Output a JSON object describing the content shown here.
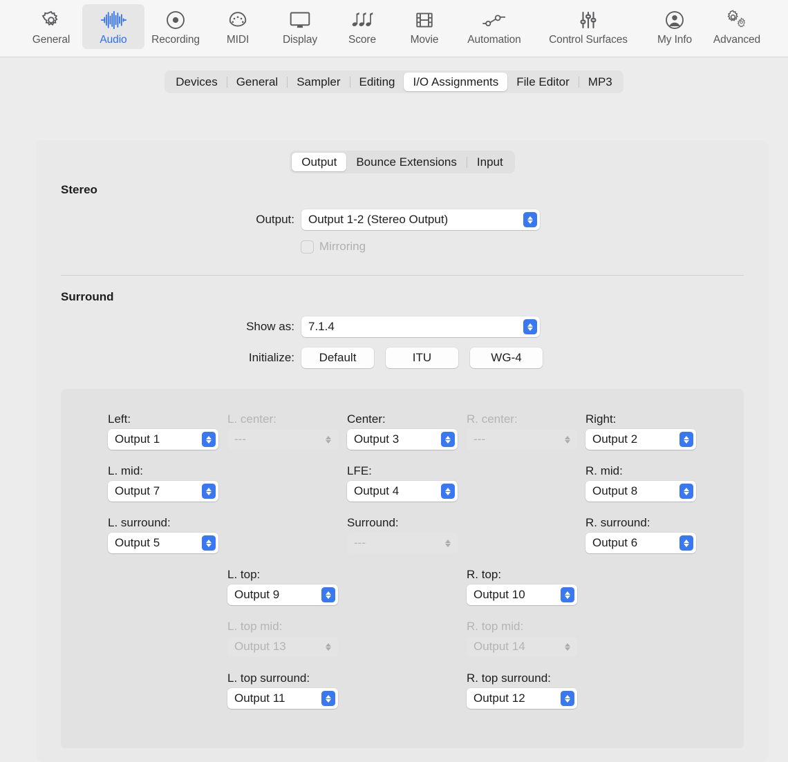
{
  "toolbar": {
    "items": [
      {
        "label": "General",
        "icon": "gear-icon",
        "selected": false
      },
      {
        "label": "Audio",
        "icon": "waveform-icon",
        "selected": true
      },
      {
        "label": "Recording",
        "icon": "record-circle-icon",
        "selected": false
      },
      {
        "label": "MIDI",
        "icon": "midi-connector-icon",
        "selected": false
      },
      {
        "label": "Display",
        "icon": "monitor-icon",
        "selected": false
      },
      {
        "label": "Score",
        "icon": "music-notes-icon",
        "selected": false
      },
      {
        "label": "Movie",
        "icon": "film-strip-icon",
        "selected": false
      },
      {
        "label": "Automation",
        "icon": "automation-node-icon",
        "selected": false
      },
      {
        "label": "Control Surfaces",
        "icon": "sliders-icon",
        "selected": false
      },
      {
        "label": "My Info",
        "icon": "person-circle-icon",
        "selected": false
      },
      {
        "label": "Advanced",
        "icon": "double-gear-icon",
        "selected": false
      }
    ]
  },
  "tabs": {
    "items": [
      {
        "label": "Devices",
        "active": false
      },
      {
        "label": "General",
        "active": false
      },
      {
        "label": "Sampler",
        "active": false
      },
      {
        "label": "Editing",
        "active": false
      },
      {
        "label": "I/O Assignments",
        "active": true
      },
      {
        "label": "File Editor",
        "active": false
      },
      {
        "label": "MP3",
        "active": false
      }
    ]
  },
  "subtabs": {
    "items": [
      {
        "label": "Output",
        "active": true
      },
      {
        "label": "Bounce Extensions",
        "active": false
      },
      {
        "label": "Input",
        "active": false
      }
    ]
  },
  "stereo": {
    "title": "Stereo",
    "output_label": "Output:",
    "output_value": "Output 1-2 (Stereo Output)",
    "mirroring_label": "Mirroring",
    "mirroring_checked": false,
    "mirroring_enabled": false
  },
  "surround": {
    "title": "Surround",
    "show_as_label": "Show as:",
    "show_as_value": "7.1.4",
    "initialize_label": "Initialize:",
    "initialize_buttons": [
      "Default",
      "ITU",
      "WG-4"
    ],
    "channels": [
      {
        "label": "Left:",
        "value": "Output 1",
        "enabled": true
      },
      {
        "label": "L. center:",
        "value": "---",
        "enabled": false
      },
      {
        "label": "Center:",
        "value": "Output 3",
        "enabled": true
      },
      {
        "label": "R. center:",
        "value": "---",
        "enabled": false
      },
      {
        "label": "Right:",
        "value": "Output 2",
        "enabled": true
      },
      {
        "label": "L. mid:",
        "value": "Output 7",
        "enabled": true
      },
      {
        "label": "LFE:",
        "value": "Output 4",
        "enabled": true
      },
      {
        "label": "R. mid:",
        "value": "Output 8",
        "enabled": true
      },
      {
        "label": "L. surround:",
        "value": "Output 5",
        "enabled": true
      },
      {
        "label": "Surround:",
        "value": "---",
        "enabled": false
      },
      {
        "label": "R. surround:",
        "value": "Output 6",
        "enabled": true
      },
      {
        "label": "L. top:",
        "value": "Output 9",
        "enabled": true
      },
      {
        "label": "R. top:",
        "value": "Output 10",
        "enabled": true
      },
      {
        "label": "L. top mid:",
        "value": "Output 13",
        "enabled": false
      },
      {
        "label": "R. top mid:",
        "value": "Output 14",
        "enabled": false
      },
      {
        "label": "L. top surround:",
        "value": "Output 11",
        "enabled": true
      },
      {
        "label": "R. top surround:",
        "value": "Output 12",
        "enabled": true
      }
    ]
  },
  "colors": {
    "accent": "#3a78f2",
    "window_bg": "#ececec",
    "toolbar_bg": "#f6f6f6",
    "panel_bg": "#e9e9e9",
    "grid_panel_bg": "#e2e2e2",
    "text": "#1d1d1f",
    "disabled_text": "#b4b4b4"
  }
}
